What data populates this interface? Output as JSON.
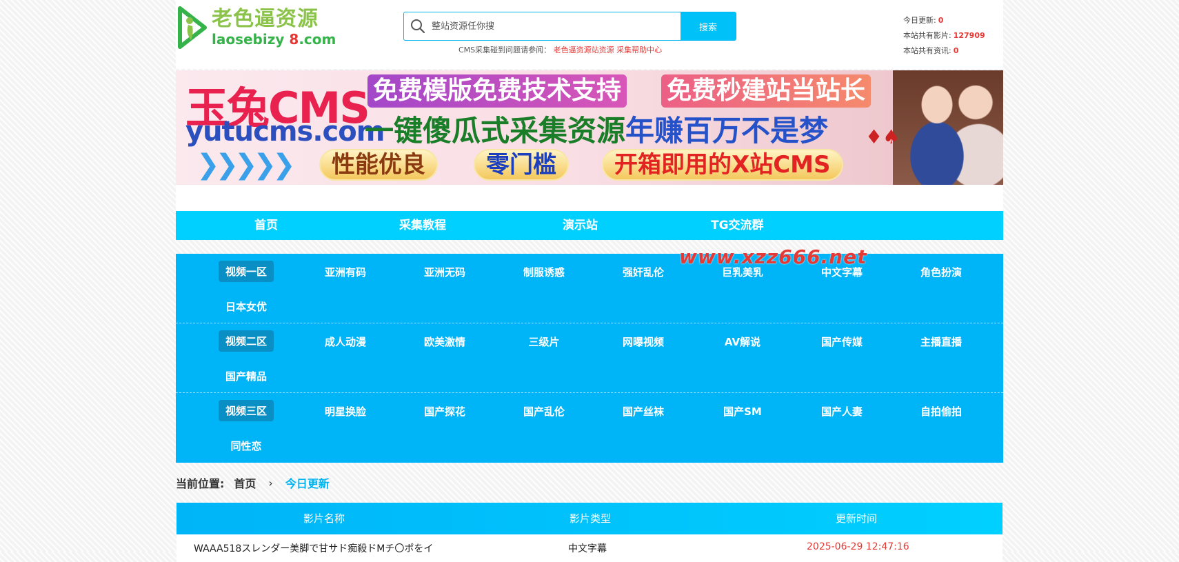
{
  "header": {
    "logo_cn": "老色逼资源",
    "logo_en_prefix": "laosebizy",
    "logo_en_num": "8",
    "logo_en_suffix": ".com",
    "search_placeholder": "整站资源任你搜",
    "search_button": "搜索",
    "help_prefix": "CMS采集碰到问题请参阅：",
    "help_link1": "老色逼资源站资源",
    "help_link2": "采集帮助中心",
    "stats": [
      {
        "label": "今日更新:",
        "value": "0"
      },
      {
        "label": "本站共有影片:",
        "value": "127909"
      },
      {
        "label": "本站共有资讯:",
        "value": "0"
      }
    ]
  },
  "banner": {
    "brand": "玉兔CMS",
    "url": "yutucms.com",
    "pill1": "免费模版免费技术支持",
    "pill2": "免费秒建站当站长",
    "line2_green": "一键傻瓜式采集资源",
    "line2_blue": "年赚百万不是梦",
    "btn1": "性能优良",
    "btn2": "零门槛",
    "btn3": "开箱即用的X站CMS"
  },
  "nav": [
    "首页",
    "采集教程",
    "演示站",
    "TG交流群"
  ],
  "watermark": "www.xzz666.net",
  "categories": [
    {
      "head": "视频一区",
      "items": [
        "亚洲有码",
        "亚洲无码",
        "制服诱惑",
        "强奸乱伦",
        "巨乳美乳",
        "中文字幕",
        "角色扮演",
        "日本女优"
      ]
    },
    {
      "head": "视频二区",
      "items": [
        "成人动漫",
        "欧美激情",
        "三级片",
        "网曝视频",
        "AV解说",
        "国产传媒",
        "主播直播",
        "国产精品"
      ]
    },
    {
      "head": "视频三区",
      "items": [
        "明星换脸",
        "国产探花",
        "国产乱伦",
        "国产丝袜",
        "国产SM",
        "国产人妻",
        "自拍偷拍",
        "同性恋"
      ]
    }
  ],
  "breadcrumb": {
    "label": "当前位置:",
    "home": "首页",
    "sep": "›",
    "current": "今日更新"
  },
  "table": {
    "headers": [
      "影片名称",
      "影片类型",
      "更新时间"
    ],
    "rows": [
      {
        "name": "WAAA518スレンダー美脚で甘サド痴殺ドMチ〇ポをイ",
        "type": "中文字幕",
        "time": "2025-06-29 12:47:16"
      }
    ]
  },
  "colors": {
    "accent": "#00b4f8",
    "nav": "#00d0ff",
    "red": "#e53935"
  }
}
